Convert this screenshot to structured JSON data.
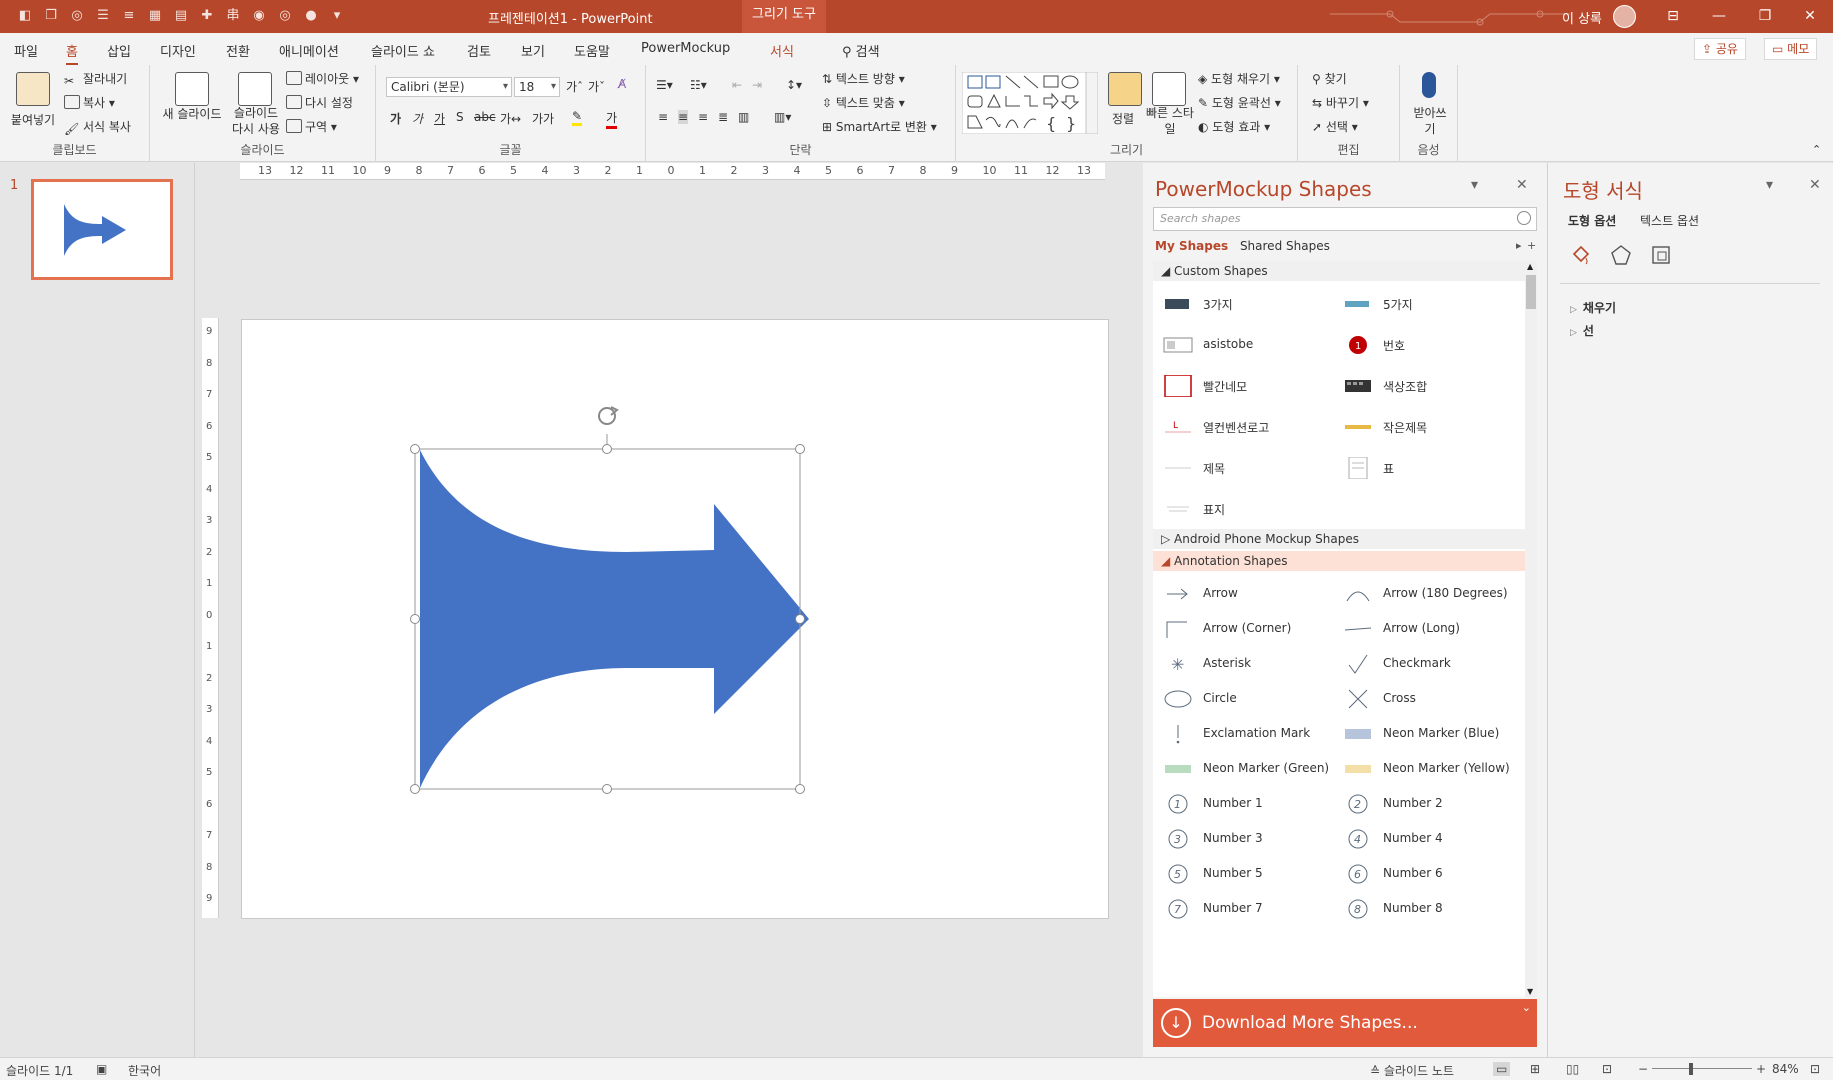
{
  "titlebar": {
    "title": "프레젠테이션1  -  PowerPoint",
    "context_tab": "그리기 도구",
    "user": "이 상록",
    "qat_icons": [
      "shape-icon",
      "copy-icon",
      "layers-icon",
      "bullets-icon",
      "list-icon",
      "table-icon",
      "grid-icon",
      "add-icon",
      "align-icon",
      "merge-icon",
      "union-icon",
      "combine-icon",
      "customize-icon"
    ]
  },
  "tabs": {
    "items": [
      "파일",
      "홈",
      "삽입",
      "디자인",
      "전환",
      "애니메이션",
      "슬라이드 쇼",
      "검토",
      "보기",
      "도움말",
      "PowerMockup",
      "서식"
    ],
    "search": "검색",
    "share": "공유",
    "comments": "메모"
  },
  "ribbon": {
    "clipboard": {
      "label": "클립보드",
      "paste": "붙여넣기",
      "cut": "잘라내기",
      "copy": "복사",
      "format_painter": "서식 복사"
    },
    "slides": {
      "label": "슬라이드",
      "new_slide": "새 슬라이드",
      "reuse": "슬라이드 다시 사용",
      "layout": "레이아웃",
      "reset": "다시 설정",
      "section": "구역"
    },
    "font": {
      "label": "글꼴",
      "font_name": "Calibri (본문)",
      "font_size": "18"
    },
    "paragraph": {
      "label": "단락",
      "text_direction": "텍스트 방향",
      "align_text": "텍스트 맞춤",
      "smartart": "SmartArt로 변환"
    },
    "drawing": {
      "label": "그리기",
      "arrange": "정렬",
      "quick_styles": "빠른 스타일",
      "fill": "도형 채우기",
      "outline": "도형 윤곽선",
      "effects": "도형 효과"
    },
    "editing": {
      "label": "편집",
      "find": "찾기",
      "replace": "바꾸기",
      "select": "선택"
    },
    "voice": {
      "label": "음성",
      "dictate": "받아쓰기"
    }
  },
  "thumbnails": {
    "slide_number": "1"
  },
  "ruler": {
    "h_ticks": [
      "13",
      "12",
      "11",
      "10",
      "9",
      "8",
      "7",
      "6",
      "5",
      "4",
      "3",
      "2",
      "1",
      "0",
      "1",
      "2",
      "3",
      "4",
      "5",
      "6",
      "7",
      "8",
      "9",
      "10",
      "11",
      "12",
      "13"
    ],
    "v_ticks": [
      "9",
      "8",
      "7",
      "6",
      "5",
      "4",
      "3",
      "2",
      "1",
      "0",
      "1",
      "2",
      "3",
      "4",
      "5",
      "6",
      "7",
      "8",
      "9"
    ]
  },
  "slide": {
    "shape_fill": "#4472c4",
    "shape": "arrow-shape"
  },
  "powermockup": {
    "title": "PowerMockup Shapes",
    "search_placeholder": "Search shapes",
    "my_shapes": "My Shapes",
    "shared_shapes": "Shared Shapes",
    "sections": {
      "custom": "Custom Shapes",
      "android": "Android Phone Mockup Shapes",
      "annotation": "Annotation Shapes"
    },
    "custom_items": [
      "3가지",
      "5가지",
      "asistobe",
      "번호",
      "빨간네모",
      "색상조합",
      "열컨벤션로고",
      "작은제목",
      "제목",
      "표",
      "표지"
    ],
    "annotation_items": [
      "Arrow",
      "Arrow (180 Degrees)",
      "Arrow (Corner)",
      "Arrow (Long)",
      "Asterisk",
      "Checkmark",
      "Circle",
      "Cross",
      "Exclamation Mark",
      "Neon Marker (Blue)",
      "Neon Marker (Green)",
      "Neon Marker (Yellow)",
      "Number 1",
      "Number 2",
      "Number 3",
      "Number 4",
      "Number 5",
      "Number 6",
      "Number 7",
      "Number 8"
    ],
    "download": "Download More Shapes..."
  },
  "format_pane": {
    "title": "도형 서식",
    "tab_shape": "도형 옵션",
    "tab_text": "텍스트 옵션",
    "fill": "채우기",
    "line": "선"
  },
  "statusbar": {
    "slide": "슬라이드 1/1",
    "language": "한국어",
    "notes": "슬라이드 노트",
    "zoom": "84%"
  },
  "colors": {
    "accent": "#b7472a",
    "download": "#e05a3b",
    "shape": "#4472c4"
  }
}
